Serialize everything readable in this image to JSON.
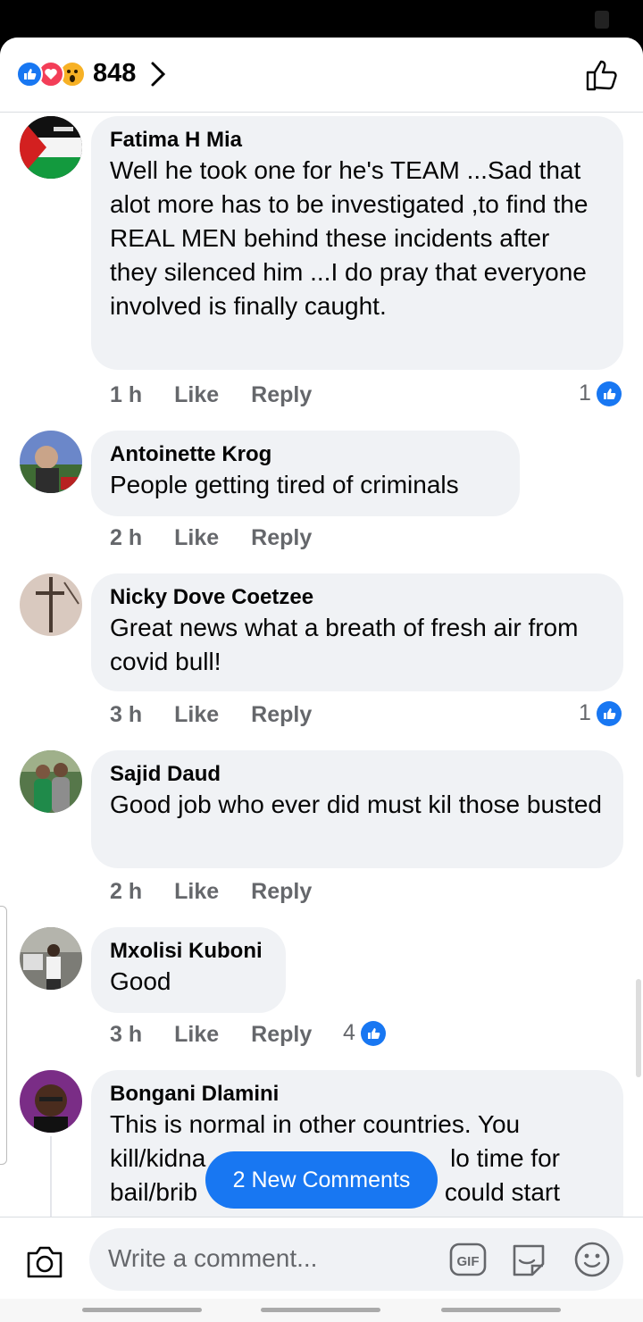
{
  "header": {
    "reaction_count": "848",
    "reaction_icons": [
      "like-icon",
      "love-icon",
      "wow-icon"
    ]
  },
  "comments": [
    {
      "author": "Fatima H Mia",
      "text": "Well he took one for he's TEAM ...Sad that alot more has to be investigated ,to find the REAL MEN behind these incidents after they silenced him ...I do pray that everyone involved is finally caught.",
      "time": "1 h",
      "like": "Like",
      "reply": "Reply",
      "likes": "1"
    },
    {
      "author": "Antoinette Krog",
      "text": "People getting tired of criminals",
      "time": "2 h",
      "like": "Like",
      "reply": "Reply",
      "likes": ""
    },
    {
      "author": "Nicky Dove Coetzee",
      "text": "Great news what a breath of fresh air from covid bull!",
      "time": "3 h",
      "like": "Like",
      "reply": "Reply",
      "likes": "1"
    },
    {
      "author": "Sajid Daud",
      "text": "Good job who ever did must kil those busted",
      "time": "2 h",
      "like": "Like",
      "reply": "Reply",
      "likes": ""
    },
    {
      "author": "Mxolisi Kuboni",
      "text": "Good",
      "time": "3 h",
      "like": "Like",
      "reply": "Reply",
      "likes": "4"
    },
    {
      "author": "Bongani Dlamini",
      "text_lines": [
        "This is normal in other countries. You",
        "kill/kidna",
        "bail/brib"
      ],
      "text_lines_right": [
        "lo time for",
        "could start"
      ]
    }
  ],
  "new_comments_pill": "2 New Comments",
  "composer": {
    "placeholder": "Write a comment...",
    "gif_label": "GIF"
  },
  "colors": {
    "accent": "#1877f2",
    "bubble": "#f0f2f5",
    "meta_text": "#65676b",
    "love": "#f33e58",
    "wow": "#f7b125"
  }
}
